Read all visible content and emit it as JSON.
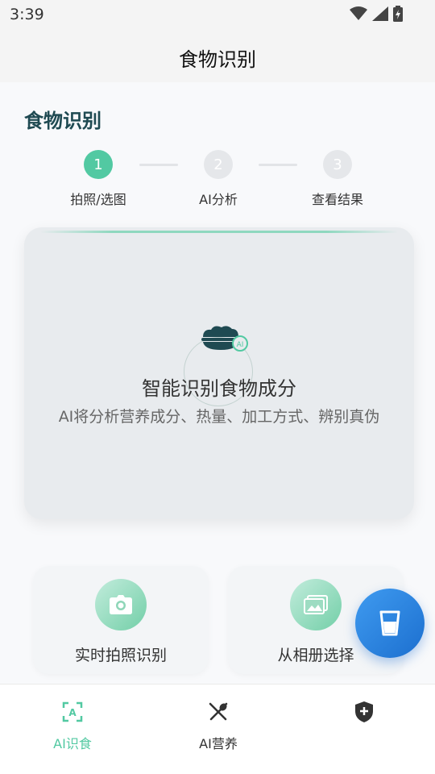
{
  "status_bar": {
    "time": "3:39"
  },
  "app_bar": {
    "title": "食物识别"
  },
  "section": {
    "title": "食物识别"
  },
  "steps": [
    {
      "number": "1",
      "label": "拍照/选图",
      "active": true
    },
    {
      "number": "2",
      "label": "AI分析",
      "active": false
    },
    {
      "number": "3",
      "label": "查看结果",
      "active": false
    }
  ],
  "main_card": {
    "title": "智能识别食物成分",
    "subtitle": "AI将分析营养成分、热量、加工方式、辨别真伪",
    "badge": "AI"
  },
  "actions": {
    "camera_label": "实时拍照识别",
    "gallery_label": "从相册选择"
  },
  "bottom_nav": {
    "items": [
      {
        "label": "AI识食",
        "icon": "ai-scan-icon",
        "active": true
      },
      {
        "label": "AI营养",
        "icon": "fork-knife-icon",
        "active": false
      },
      {
        "label": "",
        "icon": "shield-plus-icon",
        "active": false
      }
    ]
  },
  "colors": {
    "accent": "#52c9a2",
    "title": "#1f4a52",
    "fab": "#2a80e0"
  }
}
